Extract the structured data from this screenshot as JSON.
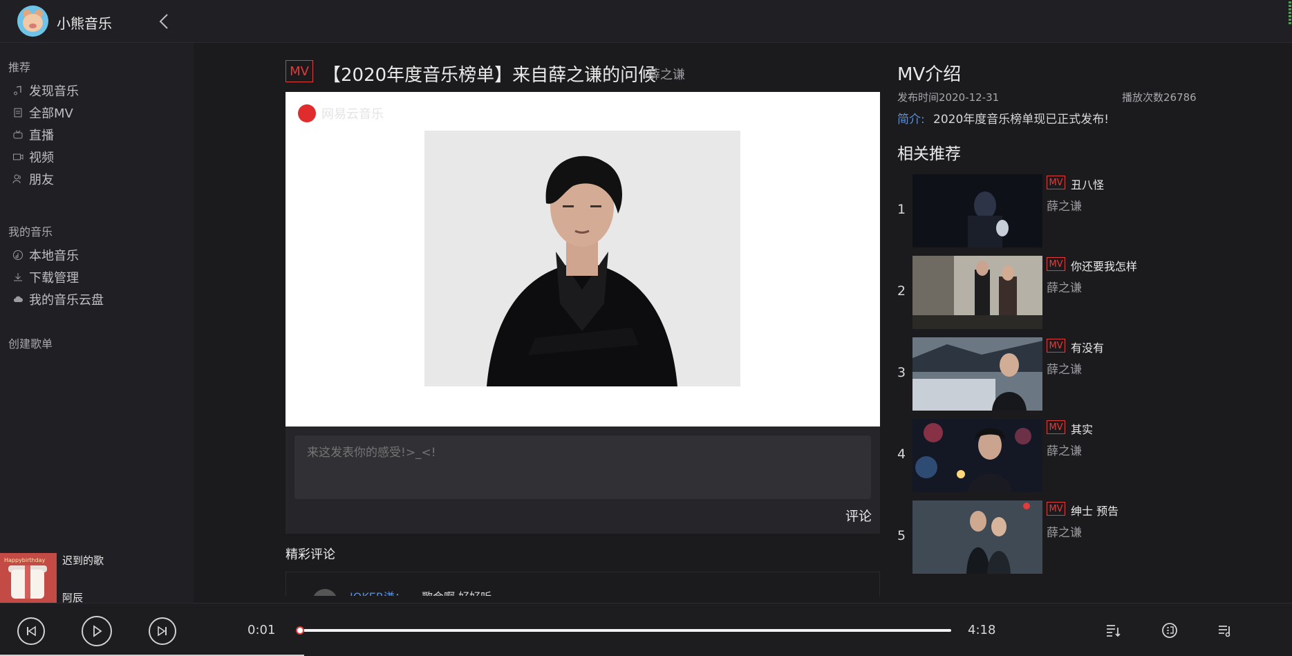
{
  "app": {
    "title": "小熊音乐"
  },
  "sidebar": {
    "sections": [
      {
        "title": "推荐",
        "items": [
          "发现音乐",
          "全部MV",
          "直播",
          "视频",
          "朋友"
        ]
      },
      {
        "title": "我的音乐",
        "items": [
          "本地音乐",
          "下载管理",
          "我的音乐云盘"
        ]
      },
      {
        "title": "创建歌单",
        "items": []
      }
    ]
  },
  "now_playing": {
    "song": "迟到的歌",
    "artist": "阿辰",
    "cover_text": "Happybirthday"
  },
  "mv": {
    "tag": "MV",
    "title": "【2020年度音乐榜单】来自薛之谦的问候",
    "artist": "薛之谦",
    "watermark": "网易云音乐"
  },
  "comment": {
    "placeholder": "来这发表你的感受!>_<!",
    "submit_label": "评论"
  },
  "hot_comments": {
    "title": "精彩评论",
    "preview_user": "JOKER谦：",
    "preview_text": "歌会啊 好好听"
  },
  "intro": {
    "title": "MV介绍",
    "publish": "发布时间2020-12-31",
    "plays": "播放次数26786",
    "desc_label": "简介:",
    "desc": "2020年度音乐榜单现已正式发布!"
  },
  "related": {
    "title": "相关推荐",
    "items": [
      {
        "index": "1",
        "tag": "MV",
        "name": "丑八怪",
        "artist": "薛之谦"
      },
      {
        "index": "2",
        "tag": "MV",
        "name": "你还要我怎样",
        "artist": "薛之谦"
      },
      {
        "index": "3",
        "tag": "MV",
        "name": "有没有",
        "artist": "薛之谦"
      },
      {
        "index": "4",
        "tag": "MV",
        "name": "其实",
        "artist": "薛之谦"
      },
      {
        "index": "5",
        "tag": "MV",
        "name": "绅士 预告",
        "artist": "薛之谦"
      }
    ]
  },
  "player": {
    "current_time": "0:01",
    "total_time": "4:18",
    "progress": 0.004
  },
  "colors": {
    "accent": "#e23b3b",
    "link": "#5b8fd6",
    "background": "#1b1b1e"
  }
}
